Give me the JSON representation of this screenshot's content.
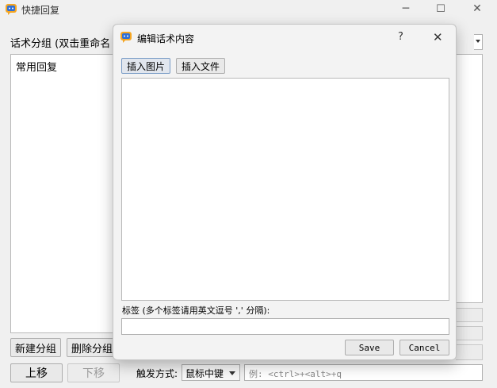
{
  "main": {
    "title": "快捷回复",
    "minimize_glyph": "─",
    "maximize_glyph": "☐",
    "close_glyph": "✕",
    "group_label": "话术分组 (双击重命名",
    "groups": [
      "常用回复"
    ],
    "new_group_label": "新建分组",
    "delete_group_label": "删除分组",
    "move_up_label": "上移",
    "move_down_label": "下移",
    "trigger_label": "触发方式:",
    "trigger_value": "鼠标中键",
    "hotkey_placeholder": "例: <ctrl>+<alt>+q",
    "icon": "chat-app-icon"
  },
  "dialog": {
    "title": "编辑话术内容",
    "help_glyph": "?",
    "close_glyph": "✕",
    "insert_image_label": "插入图片",
    "insert_file_label": "插入文件",
    "content_value": "",
    "tags_label": "标签 (多个标签请用英文逗号 ',' 分隔):",
    "tags_value": "",
    "save_label": "Save",
    "cancel_label": "Cancel"
  },
  "colors": {
    "window_bg": "#f0f0f0",
    "panel_bg": "#ffffff",
    "border": "#b8b8b8",
    "disabled_text": "#9b9b9b"
  }
}
